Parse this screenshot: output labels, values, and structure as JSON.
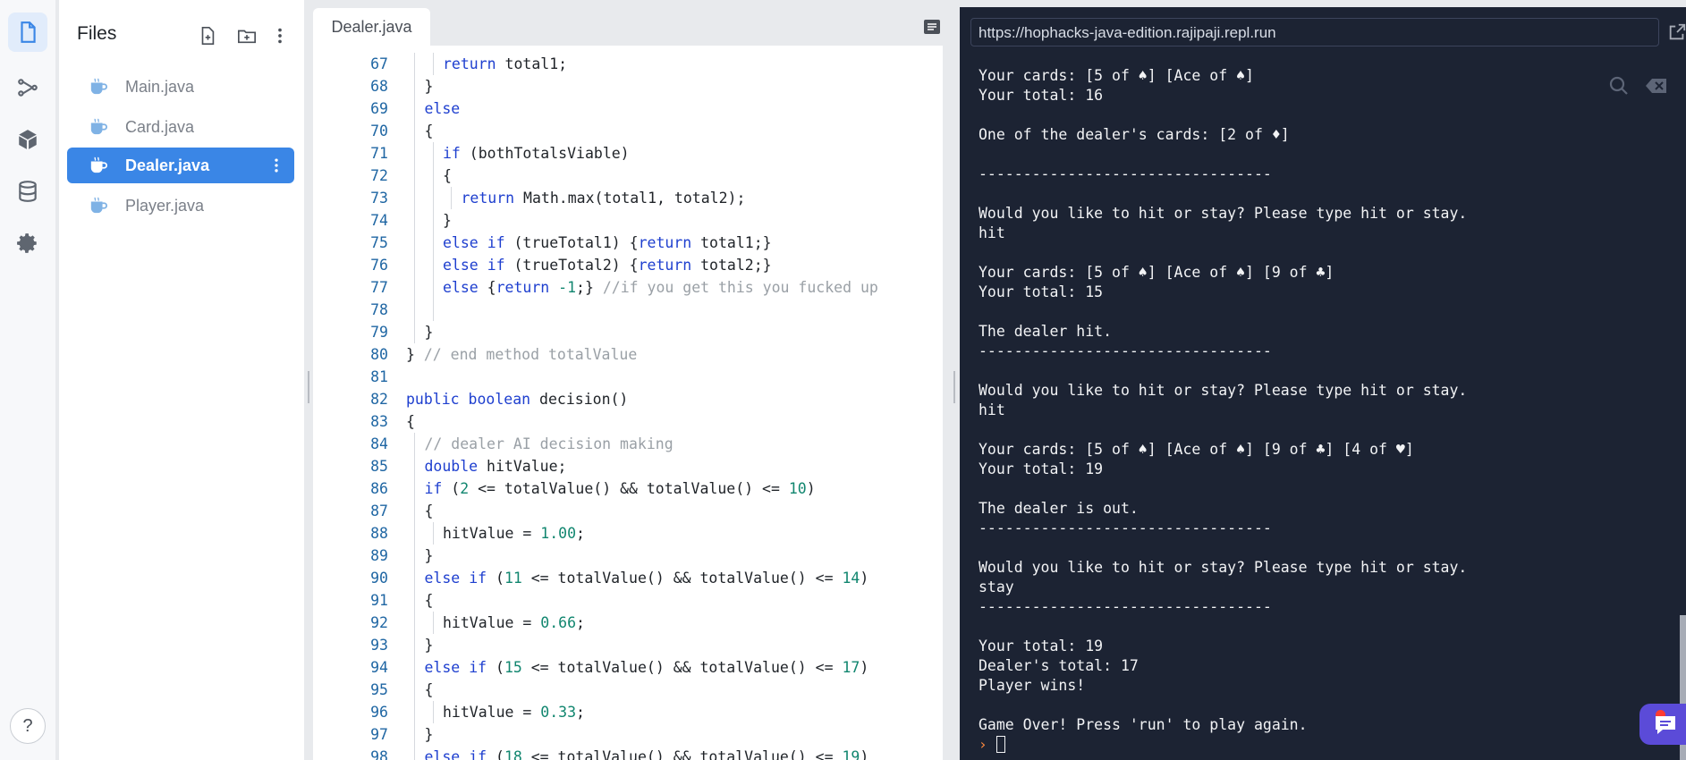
{
  "rail": {
    "items": [
      "files-icon",
      "version-control-icon",
      "packages-icon",
      "database-icon",
      "settings-icon"
    ],
    "help_label": "?"
  },
  "files_panel": {
    "title": "Files",
    "files": [
      {
        "name": "Main.java",
        "active": false
      },
      {
        "name": "Card.java",
        "active": false
      },
      {
        "name": "Dealer.java",
        "active": true
      },
      {
        "name": "Player.java",
        "active": false
      }
    ]
  },
  "editor": {
    "tab_label": "Dealer.java",
    "lines": [
      {
        "n": "67",
        "indent": 2,
        "code": "return total1;"
      },
      {
        "n": "68",
        "indent": 1,
        "code": "}"
      },
      {
        "n": "69",
        "indent": 1,
        "code": "else"
      },
      {
        "n": "70",
        "indent": 1,
        "code": "{"
      },
      {
        "n": "71",
        "indent": 2,
        "code": "if (bothTotalsViable)"
      },
      {
        "n": "72",
        "indent": 2,
        "code": "{"
      },
      {
        "n": "73",
        "indent": 3,
        "code": "return Math.max(total1, total2);"
      },
      {
        "n": "74",
        "indent": 2,
        "code": "}"
      },
      {
        "n": "75",
        "indent": 2,
        "code": "else if (trueTotal1) {return total1;}"
      },
      {
        "n": "76",
        "indent": 2,
        "code": "else if (trueTotal2) {return total2;}"
      },
      {
        "n": "77",
        "indent": 2,
        "code": "else {return -1;} //if you get this you fucked up"
      },
      {
        "n": "78",
        "indent": 2,
        "code": ""
      },
      {
        "n": "79",
        "indent": 1,
        "code": "}"
      },
      {
        "n": "80",
        "indent": 0,
        "code": "} // end method totalValue"
      },
      {
        "n": "81",
        "indent": 0,
        "code": ""
      },
      {
        "n": "82",
        "indent": 0,
        "code": "public boolean decision()"
      },
      {
        "n": "83",
        "indent": 0,
        "code": "{"
      },
      {
        "n": "84",
        "indent": 1,
        "code": "// dealer AI decision making"
      },
      {
        "n": "85",
        "indent": 1,
        "code": "double hitValue;"
      },
      {
        "n": "86",
        "indent": 1,
        "code": "if (2 <= totalValue() && totalValue() <= 10)"
      },
      {
        "n": "87",
        "indent": 1,
        "code": "{"
      },
      {
        "n": "88",
        "indent": 2,
        "code": "hitValue = 1.00;"
      },
      {
        "n": "89",
        "indent": 1,
        "code": "}"
      },
      {
        "n": "90",
        "indent": 1,
        "code": "else if (11 <= totalValue() && totalValue() <= 14)"
      },
      {
        "n": "91",
        "indent": 1,
        "code": "{"
      },
      {
        "n": "92",
        "indent": 2,
        "code": "hitValue = 0.66;"
      },
      {
        "n": "93",
        "indent": 1,
        "code": "}"
      },
      {
        "n": "94",
        "indent": 1,
        "code": "else if (15 <= totalValue() && totalValue() <= 17)"
      },
      {
        "n": "95",
        "indent": 1,
        "code": "{"
      },
      {
        "n": "96",
        "indent": 2,
        "code": "hitValue = 0.33;"
      },
      {
        "n": "97",
        "indent": 1,
        "code": "}"
      },
      {
        "n": "98",
        "indent": 1,
        "code": "else if (18 <= totalValue() && totalValue() <= 19)"
      }
    ]
  },
  "console": {
    "url": "https://hophacks-java-edition.rajipaji.repl.run",
    "prompt_symbol": "›",
    "lines": [
      "Your cards: [5 of ♠] [Ace of ♠]",
      "Your total: 16",
      "",
      "One of the dealer's cards: [2 of ♦]",
      "",
      "---------------------------------",
      "",
      "Would you like to hit or stay? Please type hit or stay.",
      "hit",
      "",
      "Your cards: [5 of ♠] [Ace of ♠] [9 of ♣]",
      "Your total: 15",
      "",
      "The dealer hit.",
      "---------------------------------",
      "",
      "Would you like to hit or stay? Please type hit or stay.",
      "hit",
      "",
      "Your cards: [5 of ♠] [Ace of ♠] [9 of ♣] [4 of ♥]",
      "Your total: 19",
      "",
      "The dealer is out.",
      "---------------------------------",
      "",
      "Would you like to hit or stay? Please type hit or stay.",
      "stay",
      "---------------------------------",
      "",
      "Your total: 19",
      "Dealer's total: 17",
      "Player wins!",
      "",
      "Game Over! Press 'run' to play again."
    ]
  },
  "colors": {
    "accent": "#3a86e6",
    "console_bg": "#1c2333",
    "keyword": "#1e3fcf",
    "number": "#11866f",
    "comment": "#9aa0a6"
  }
}
